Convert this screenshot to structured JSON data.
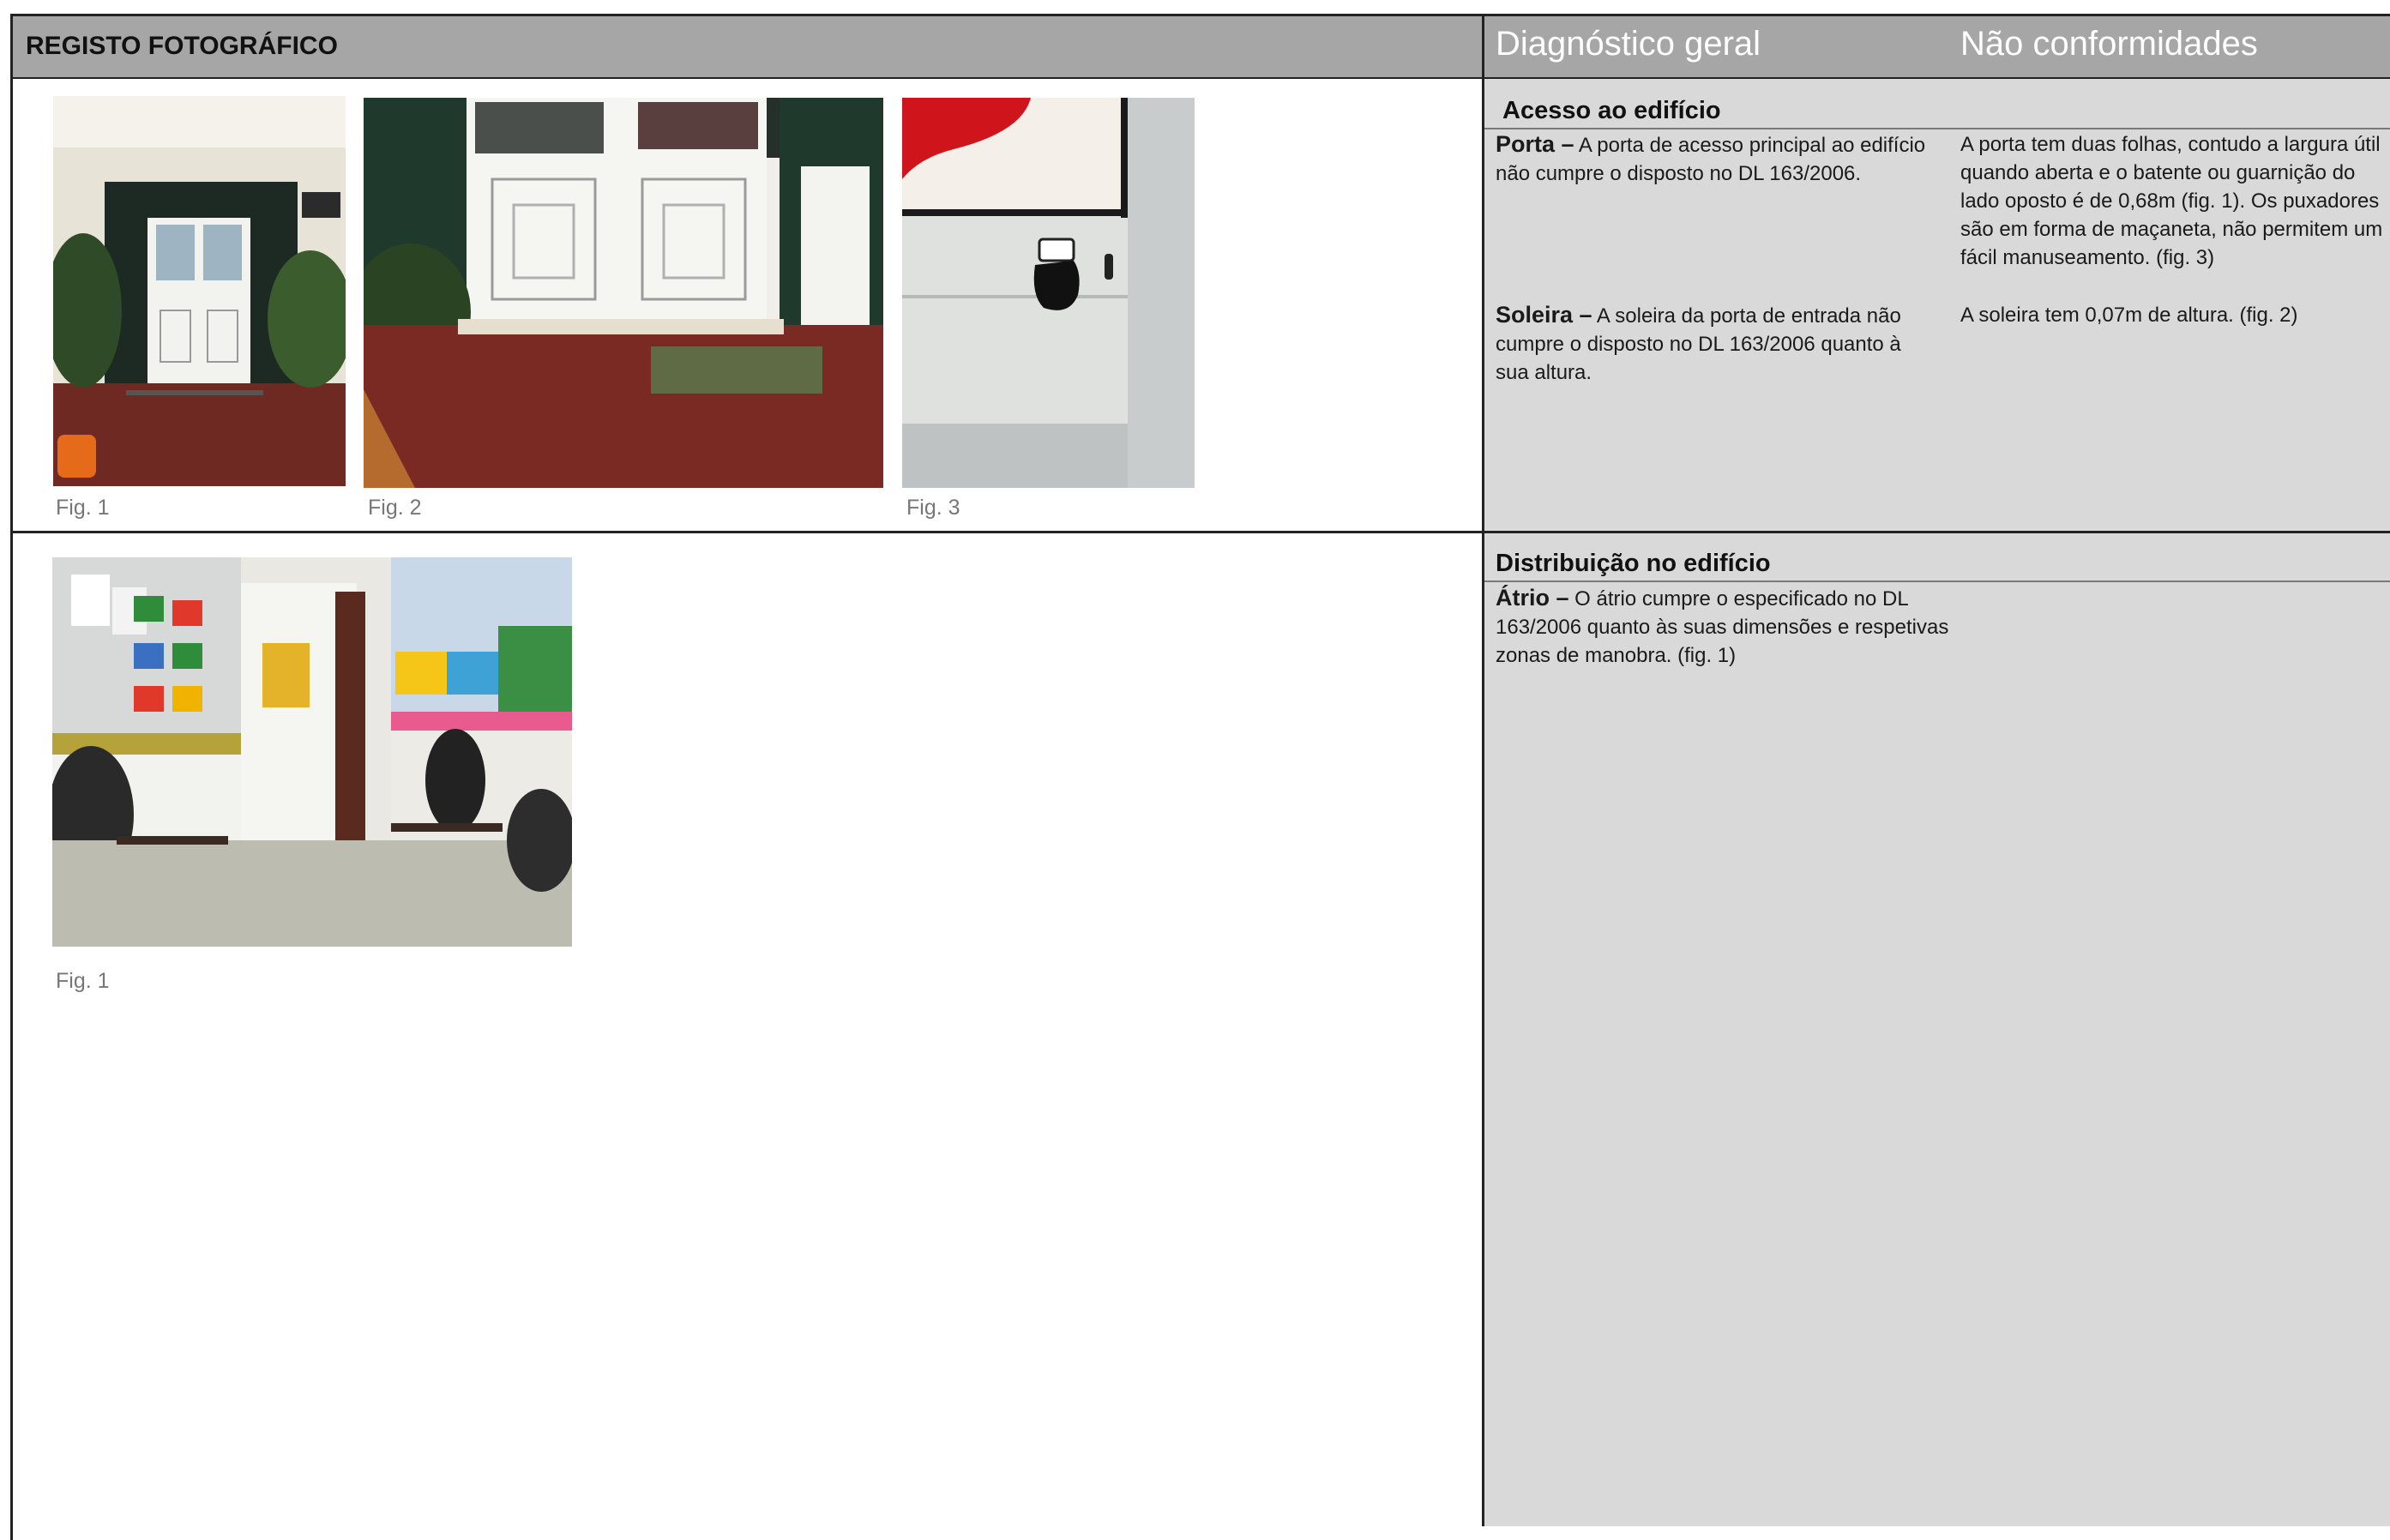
{
  "header": {
    "left_title": "REGISTO FOTOGRÁFICO",
    "col_diagnostico": "Diagnóstico geral",
    "col_nao_conformidades": "Não conformidades"
  },
  "sections": [
    {
      "title": "Acesso ao edifício",
      "figures": [
        "Fig. 1",
        "Fig. 2",
        "Fig. 3"
      ],
      "rows": [
        {
          "term": "Porta –",
          "diagnostico": " A porta de acesso principal ao edifício não cumpre o disposto no DL 163/2006.",
          "nao_conformidade": "A porta tem duas folhas, contudo a largura útil quando aberta e o batente ou guarnição do lado oposto é de 0,68m (fig. 1). Os puxadores são em forma de maçaneta, não permitem um fácil manuseamento. (fig. 3)"
        },
        {
          "term": "Soleira –",
          "diagnostico": " A soleira da porta de entrada não cumpre o disposto no DL 163/2006 quanto à sua altura.",
          "nao_conformidade": "A soleira tem 0,07m de altura. (fig. 2)"
        }
      ]
    },
    {
      "title": "Distribuição no edifício",
      "figures": [
        "Fig. 1"
      ],
      "rows": [
        {
          "term": "Átrio –",
          "diagnostico": " O átrio cumpre o especificado no DL 163/2006 quanto às suas dimensões e respetivas zonas de manobra. (fig. 1)",
          "nao_conformidade": ""
        }
      ]
    }
  ]
}
